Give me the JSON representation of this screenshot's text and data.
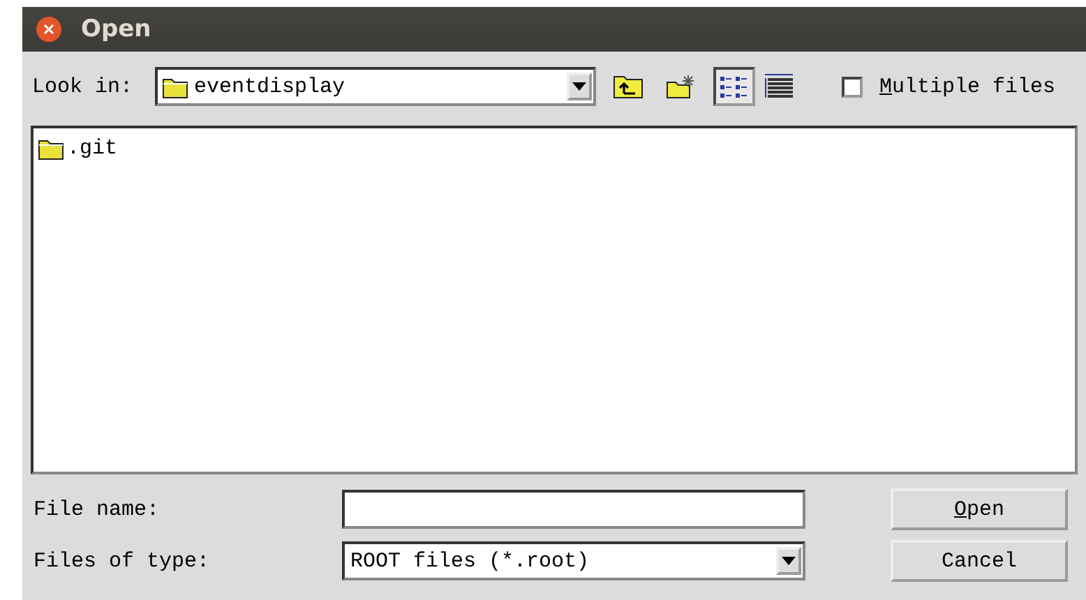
{
  "window": {
    "title": "Open"
  },
  "toolbar": {
    "look_in_label": "Look in:",
    "look_in_value": "eventdisplay",
    "view_buttons": [
      {
        "kind": "list",
        "selected": true
      },
      {
        "kind": "details",
        "selected": false
      }
    ],
    "multiple_files": {
      "label": "Multiple files",
      "first_letter_underlined": true,
      "checked": false
    }
  },
  "files": [
    {
      "name": ".git",
      "kind": "folder",
      "selected": false
    }
  ],
  "file_name": {
    "label": "File name:"
  },
  "file_type": {
    "label": "Files of type:",
    "value": "ROOT files (*.root)"
  },
  "buttons": [
    {
      "label": "Open",
      "first_letter_underlined": true
    },
    {
      "label": "Cancel",
      "first_letter_underlined": false
    }
  ]
}
